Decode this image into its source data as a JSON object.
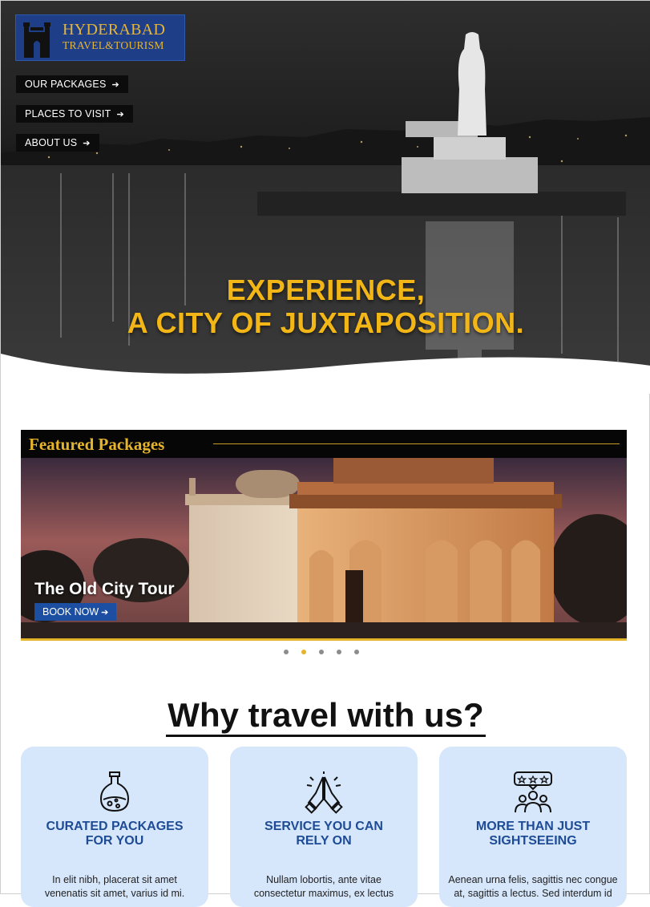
{
  "header": {
    "logo": {
      "line1": "HYDERABAD",
      "line2": "TRAVEL&TOURISM",
      "icon": "charminar-icon"
    },
    "nav": [
      {
        "label": "OUR PACKAGES",
        "arrow": "➔"
      },
      {
        "label": "PLACES TO VISIT",
        "arrow": "➔"
      },
      {
        "label": "ABOUT US",
        "arrow": "➔"
      }
    ]
  },
  "hero": {
    "title_line1": "EXPERIENCE,",
    "title_line2": "A CITY OF JUXTAPOSITION.",
    "image": "hussain-sagar-buddha-statue-night"
  },
  "featured": {
    "heading": "Featured Packages",
    "slide": {
      "title": "The Old City Tour",
      "button_label": "BOOK NOW",
      "button_arrow": "➔",
      "image": "qutb-shahi-tombs-dusk"
    },
    "carousel": {
      "count": 5,
      "active_index": 1
    }
  },
  "why": {
    "heading": "Why travel with us?",
    "cards": [
      {
        "title_line1": "CURATED PACKAGES",
        "title_line2": "FOR YOU",
        "icon": "potion-flask-icon",
        "text_line1": "In elit nibh, placerat sit amet",
        "text_line2": "venenatis sit amet, varius id mi."
      },
      {
        "title_line1": "SERVICE YOU CAN",
        "title_line2": "RELY ON",
        "icon": "namaste-hands-icon",
        "text_line1": "Nullam lobortis, ante vitae",
        "text_line2": "consectetur maximus, ex lectus"
      },
      {
        "title_line1": "MORE THAN JUST",
        "title_line2": "SIGHTSEEING",
        "icon": "group-reviews-icon",
        "text_line1": "Aenean urna felis, sagittis nec congue",
        "text_line2": "at, sagittis a lectus. Sed interdum id"
      }
    ]
  },
  "colors": {
    "accent_gold": "#f2b617",
    "brand_blue": "#1e3f88",
    "card_bg": "#d6e6fb",
    "card_title": "#1e4b95"
  }
}
